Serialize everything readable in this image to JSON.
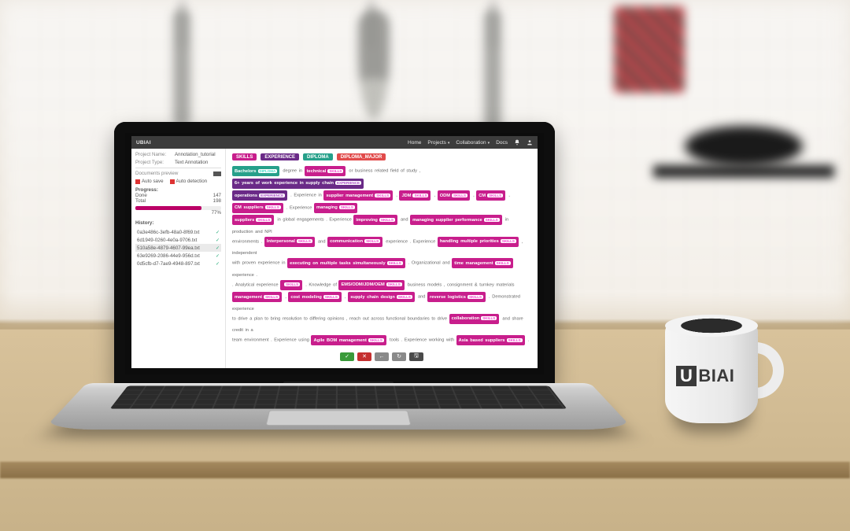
{
  "brand": "UBIAI",
  "nav": {
    "home": "Home",
    "projects": "Projects",
    "collaboration": "Collaboration",
    "docs": "Docs"
  },
  "sidebar": {
    "project_name_label": "Project Name:",
    "project_name": "Annotation_tutorial",
    "project_type_label": "Project Type:",
    "project_type": "Text Annotation",
    "documents_preview": "Documents preview",
    "auto_save": "Auto save",
    "auto_detection": "Auto detection",
    "progress_label": "Progress:",
    "stat1_k": "Done",
    "stat1_v": "147",
    "stat2_k": "Total",
    "stat2_v": "198",
    "pct": "77%",
    "history_label": "History:",
    "hist": [
      {
        "name": "0a3e486c-3efb-48a0-8f69.txt",
        "active": false
      },
      {
        "name": "6d1949-0260-4e0a-9706.txt",
        "active": false
      },
      {
        "name": "510a58e-4879-4607-99ea.txt",
        "active": true
      },
      {
        "name": "63e9269-2086-44e9-956d.txt",
        "active": false
      },
      {
        "name": "0d5cfb-d7-7ae9-4948-897.txt",
        "active": false
      }
    ]
  },
  "labels": [
    {
      "name": "SKILLS",
      "cls": "lab-skill"
    },
    {
      "name": "EXPERIENCE",
      "cls": "lab-exp"
    },
    {
      "name": "DIPLOMA",
      "cls": "lab-dip"
    },
    {
      "name": "DIPLOMA_MAJOR",
      "cls": "lab-dmaj"
    }
  ],
  "badge": {
    "SKILLS": "SKILLS",
    "EXPERIENCE": "EXPERIENCE",
    "DIPLOMA": "DIPLOMA",
    "DIPLOMA_MAJOR": "DIPLOMA_MAJOR"
  },
  "doc": [
    {
      "t": "tok",
      "cls": "c-dip",
      "text": "Bachelors",
      "tag": "DIPLOMA"
    },
    {
      "t": "txt",
      "text": " degree in "
    },
    {
      "t": "tok",
      "cls": "c-skill",
      "text": "technical",
      "tag": "SKILLS"
    },
    {
      "t": "txt",
      "text": " or business related field of study , "
    },
    {
      "t": "tok",
      "cls": "c-exp",
      "text": "6+ years of work experience in supply chain",
      "tag": "EXPERIENCE"
    },
    {
      "t": "br"
    },
    {
      "t": "tok",
      "cls": "c-exp",
      "text": "operations",
      "tag": "EXPERIENCE"
    },
    {
      "t": "txt",
      "text": " . Experience in "
    },
    {
      "t": "tok",
      "cls": "c-skill",
      "text": "supplier management",
      "tag": "SKILLS"
    },
    {
      "t": "txt",
      "text": " , "
    },
    {
      "t": "tok",
      "cls": "c-skill",
      "text": "JDM",
      "tag": "SKILLS"
    },
    {
      "t": "txt",
      "text": " , "
    },
    {
      "t": "tok",
      "cls": "c-skill",
      "text": "ODM",
      "tag": "SKILLS"
    },
    {
      "t": "txt",
      "text": " , "
    },
    {
      "t": "tok",
      "cls": "c-skill",
      "text": "CM",
      "tag": "SKILLS"
    },
    {
      "t": "txt",
      "text": " , "
    },
    {
      "t": "tok",
      "cls": "c-skill",
      "text": "CM suppliers",
      "tag": "SKILLS"
    },
    {
      "t": "txt",
      "text": " . Experience "
    },
    {
      "t": "tok",
      "cls": "c-skill",
      "text": "managing",
      "tag": "SKILLS"
    },
    {
      "t": "br"
    },
    {
      "t": "tok",
      "cls": "c-skill",
      "text": "suppliers",
      "tag": "SKILLS"
    },
    {
      "t": "txt",
      "text": " in global engagements . Experience "
    },
    {
      "t": "tok",
      "cls": "c-skill",
      "text": "improving",
      "tag": "SKILLS"
    },
    {
      "t": "txt",
      "text": " and "
    },
    {
      "t": "tok",
      "cls": "c-skill",
      "text": "managing supplier performance",
      "tag": "SKILLS"
    },
    {
      "t": "txt",
      "text": " in production and NPI"
    },
    {
      "t": "br"
    },
    {
      "t": "txt",
      "text": "environments . "
    },
    {
      "t": "tok",
      "cls": "c-skill",
      "text": "Interpersonal",
      "tag": "SKILLS"
    },
    {
      "t": "txt",
      "text": " and "
    },
    {
      "t": "tok",
      "cls": "c-skill",
      "text": "communication",
      "tag": "SKILLS"
    },
    {
      "t": "txt",
      "text": " experience . Experience "
    },
    {
      "t": "tok",
      "cls": "c-skill",
      "text": "handling multiple priorities",
      "tag": "SKILLS"
    },
    {
      "t": "txt",
      "text": " , independent"
    },
    {
      "t": "br"
    },
    {
      "t": "txt",
      "text": "with proven experience in "
    },
    {
      "t": "tok",
      "cls": "c-skill",
      "text": "executing on multiple tasks simultaneously",
      "tag": "SKILLS"
    },
    {
      "t": "txt",
      "text": " . Organizational and "
    },
    {
      "t": "tok",
      "cls": "c-skill",
      "text": "time management",
      "tag": "SKILLS"
    },
    {
      "t": "txt",
      "text": " experience ."
    },
    {
      "t": "br"
    },
    {
      "t": "txt",
      "text": " . Analytical experience "
    },
    {
      "t": "tok",
      "cls": "c-skill",
      "text": "",
      "tag": "SKILLS"
    },
    {
      "t": "txt",
      "text": " . Knowledge of "
    },
    {
      "t": "tok",
      "cls": "c-skill",
      "text": "EMS/ODM/JDM/OEM",
      "tag": "SKILLS"
    },
    {
      "t": "txt",
      "text": " business models , consignment & turnkey materials"
    },
    {
      "t": "br"
    },
    {
      "t": "tok",
      "cls": "c-skill",
      "text": "management",
      "tag": "SKILLS"
    },
    {
      "t": "txt",
      "text": " , "
    },
    {
      "t": "tok",
      "cls": "c-skill",
      "text": "cost modeling",
      "tag": "SKILLS"
    },
    {
      "t": "txt",
      "text": " , "
    },
    {
      "t": "tok",
      "cls": "c-skill",
      "text": "supply chain design",
      "tag": "SKILLS"
    },
    {
      "t": "txt",
      "text": " and "
    },
    {
      "t": "tok",
      "cls": "c-skill",
      "text": "reverse logistics",
      "tag": "SKILLS"
    },
    {
      "t": "txt",
      "text": " . Demonstrated experience"
    },
    {
      "t": "br"
    },
    {
      "t": "txt",
      "text": "to drive a plan to bring resolution to differing opinions , reach out across functional boundaries to drive "
    },
    {
      "t": "tok",
      "cls": "c-skill",
      "text": "collaboration",
      "tag": "SKILLS"
    },
    {
      "t": "txt",
      "text": " and share credit in a"
    },
    {
      "t": "br"
    },
    {
      "t": "txt",
      "text": "team environment . Experience using "
    },
    {
      "t": "tok",
      "cls": "c-skill",
      "text": "Agile BOM management",
      "tag": "SKILLS"
    },
    {
      "t": "txt",
      "text": " tools . Experience working with "
    },
    {
      "t": "tok",
      "cls": "c-skill",
      "text": "Asia based suppliers",
      "tag": "SKILLS"
    },
    {
      "t": "txt",
      "text": " ."
    }
  ],
  "mug_logo_rest": "BIAI"
}
